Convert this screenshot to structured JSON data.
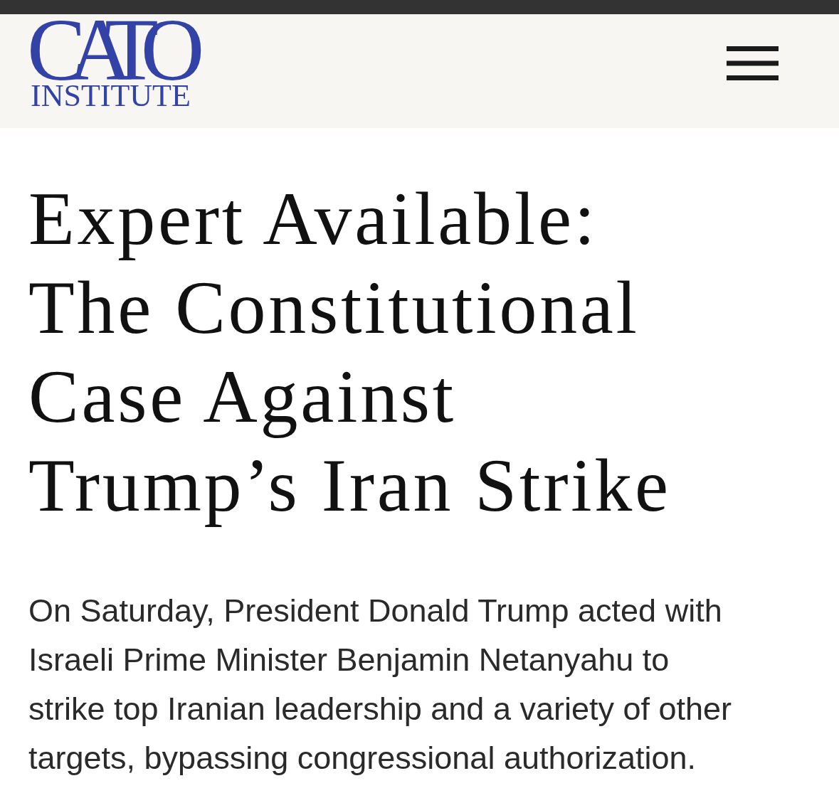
{
  "header": {
    "logo": {
      "wordmark": "CATO",
      "subtitle": "INSTITUTE"
    }
  },
  "article": {
    "title": "Expert Available:\nThe Constitutional\nCase Against\nTrump’s Iran Strike",
    "summary": "On Saturday, President Donald Trump acted with Israeli Prime Minister Benjamin Netanyahu to strike top Iranian leadership and a variety of other targets, bypassing congressional authorization."
  }
}
